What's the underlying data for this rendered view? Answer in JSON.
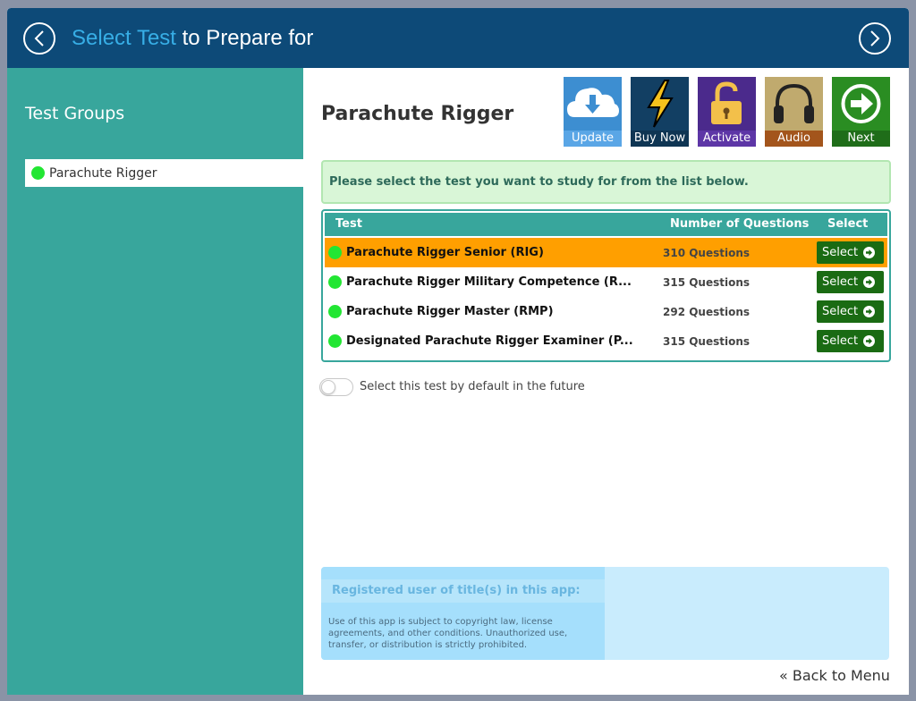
{
  "header": {
    "title_accent": "Select Test",
    "title_rest": " to Prepare for",
    "back_icon": "chevron-left-icon",
    "forward_icon": "chevron-right-icon"
  },
  "sidebar": {
    "heading": "Test Groups",
    "items": [
      {
        "label": "Parachute Rigger",
        "status_color": "#22e633"
      }
    ]
  },
  "main": {
    "title": "Parachute Rigger",
    "tiles": [
      {
        "label": "Update",
        "icon": "cloud-download-icon"
      },
      {
        "label": "Buy Now",
        "icon": "lightning-bolt-icon"
      },
      {
        "label": "Activate",
        "icon": "unlock-icon"
      },
      {
        "label": "Audio",
        "icon": "headphones-icon"
      },
      {
        "label": "Next",
        "icon": "arrow-right-circle-icon"
      }
    ],
    "instruction": "Please select the test you want to study for from the list below.",
    "table": {
      "headers": {
        "test": "Test",
        "count": "Number of Questions",
        "select": "Select"
      },
      "rows": [
        {
          "name": "Parachute Rigger Senior (RIG)",
          "count": "310 Questions",
          "select_label": "Select",
          "selected": true
        },
        {
          "name": "Parachute Rigger Military Competence (R...",
          "count": "315 Questions",
          "select_label": "Select",
          "selected": false
        },
        {
          "name": "Parachute Rigger Master (RMP)",
          "count": "292 Questions",
          "select_label": "Select",
          "selected": false
        },
        {
          "name": "Designated Parachute Rigger Examiner (P...",
          "count": "315 Questions",
          "select_label": "Select",
          "selected": false
        }
      ]
    },
    "default_toggle_label": "Select this test by default in the future",
    "registered": {
      "heading": "Registered user of title(s) in this app:",
      "notice": "Use of this app is subject to copyright law, license agreements, and other conditions. Unauthorized use, transfer, or distribution is strictly prohibited."
    },
    "back_to_menu": "Back to Menu"
  },
  "colors": {
    "header_bg": "#0d4a78",
    "accent_blue": "#37aee6",
    "sidebar_bg": "#38a69c",
    "selected_row": "#ff9f00",
    "select_button": "#1a6b13",
    "status_dot": "#22e633"
  }
}
